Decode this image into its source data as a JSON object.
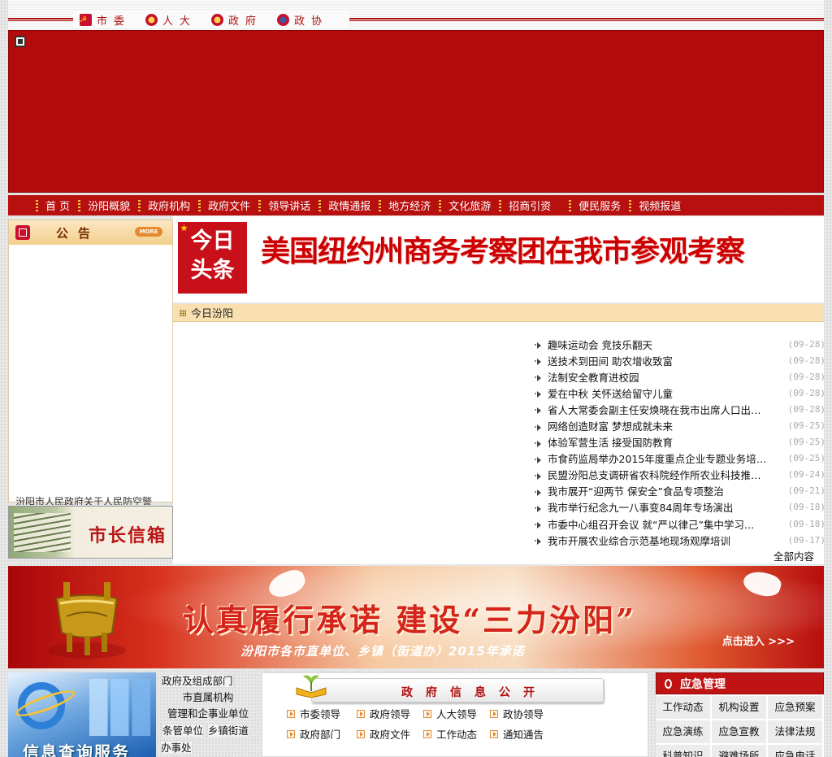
{
  "top_links": [
    {
      "label": "市委",
      "icon": "party-emblem-icon"
    },
    {
      "label": "人大",
      "icon": "national-emblem-icon"
    },
    {
      "label": "政府",
      "icon": "national-emblem-icon"
    },
    {
      "label": "政协",
      "icon": "cppcc-emblem-icon"
    }
  ],
  "nav": [
    "首 页",
    "汾阳概貌",
    "政府机构",
    "政府文件",
    "领导讲话",
    "政情通报",
    "地方经济",
    "文化旅游",
    "招商引资",
    "便民服务",
    "视频报道"
  ],
  "notice": {
    "title": "公告",
    "more": "MORE",
    "scroll_text": "汾阳市人民政府关于人民防空警"
  },
  "mayor_mailbox": "市长信箱",
  "headline": {
    "badge_line1": "今日",
    "badge_line2": "头条",
    "text": "美国纽约州商务考察团在我市参观考察"
  },
  "today_section": "今日汾阳",
  "news": [
    {
      "title": "趣味运动会 竞技乐翻天",
      "date": "(09-28)"
    },
    {
      "title": "送技术到田间 助农增收致富",
      "date": "(09-28)"
    },
    {
      "title": "法制安全教育进校园",
      "date": "(09-28)"
    },
    {
      "title": "爱在中秋 关怀送给留守儿童",
      "date": "(09-28)"
    },
    {
      "title": "省人大常委会副主任安焕晓在我市出席人口出生…",
      "date": "(09-28)"
    },
    {
      "title": "网络创造财富 梦想成就未来",
      "date": "(09-25)"
    },
    {
      "title": "体验军营生活 接受国防教育",
      "date": "(09-25)"
    },
    {
      "title": "市食药监局举办2015年度重点企业专题业务培训…",
      "date": "(09-25)"
    },
    {
      "title": "民盟汾阳总支调研省农科院经作所农业科技推广…",
      "date": "(09-24)"
    },
    {
      "title": "我市展开“迎两节 保安全”食品专项整治",
      "date": "(09-21)"
    },
    {
      "title": "我市举行纪念九一八事变84周年专场演出",
      "date": "(09-18)"
    },
    {
      "title": "市委中心组召开会议 就“严以律己”集中学习…",
      "date": "(09-18)"
    },
    {
      "title": "我市开展农业综合示范基地现场观摩培训",
      "date": "(09-17)"
    }
  ],
  "all_content": "全部内容",
  "pledge": {
    "main": "认真履行承诺  建设“三力汾阳”",
    "sub": "汾阳市各市直单位、乡镇（街道办）2015年承诺",
    "enter": "点击进入 >>>"
  },
  "info_service": "信息查询服务",
  "departments": [
    {
      "label": "政府及组成部门",
      "type": "single"
    },
    {
      "label": "市直属机构",
      "type": "single"
    },
    {
      "label": "管理和企事业单位",
      "type": "single"
    },
    {
      "label": "条管单位",
      "type": "single"
    },
    {
      "label": "乡镇街道办事处",
      "type": "single"
    }
  ],
  "gov_info": {
    "title": "政府信息公开",
    "links": [
      "市委领导",
      "政府领导",
      "人大领导",
      "政协领导",
      "政府部门",
      "政府文件",
      "工作动态",
      "通知通告"
    ]
  },
  "emergency": {
    "title": "应急管理",
    "items": [
      "工作动态",
      "机构设置",
      "应急预案",
      "应急演练",
      "应急宣教",
      "法律法规",
      "科普知识",
      "避难场所",
      "应急电话"
    ]
  },
  "colors": {
    "brand_red": "#b80f0f",
    "nav_separator": "#f5c542",
    "headline_red": "#c00000"
  }
}
